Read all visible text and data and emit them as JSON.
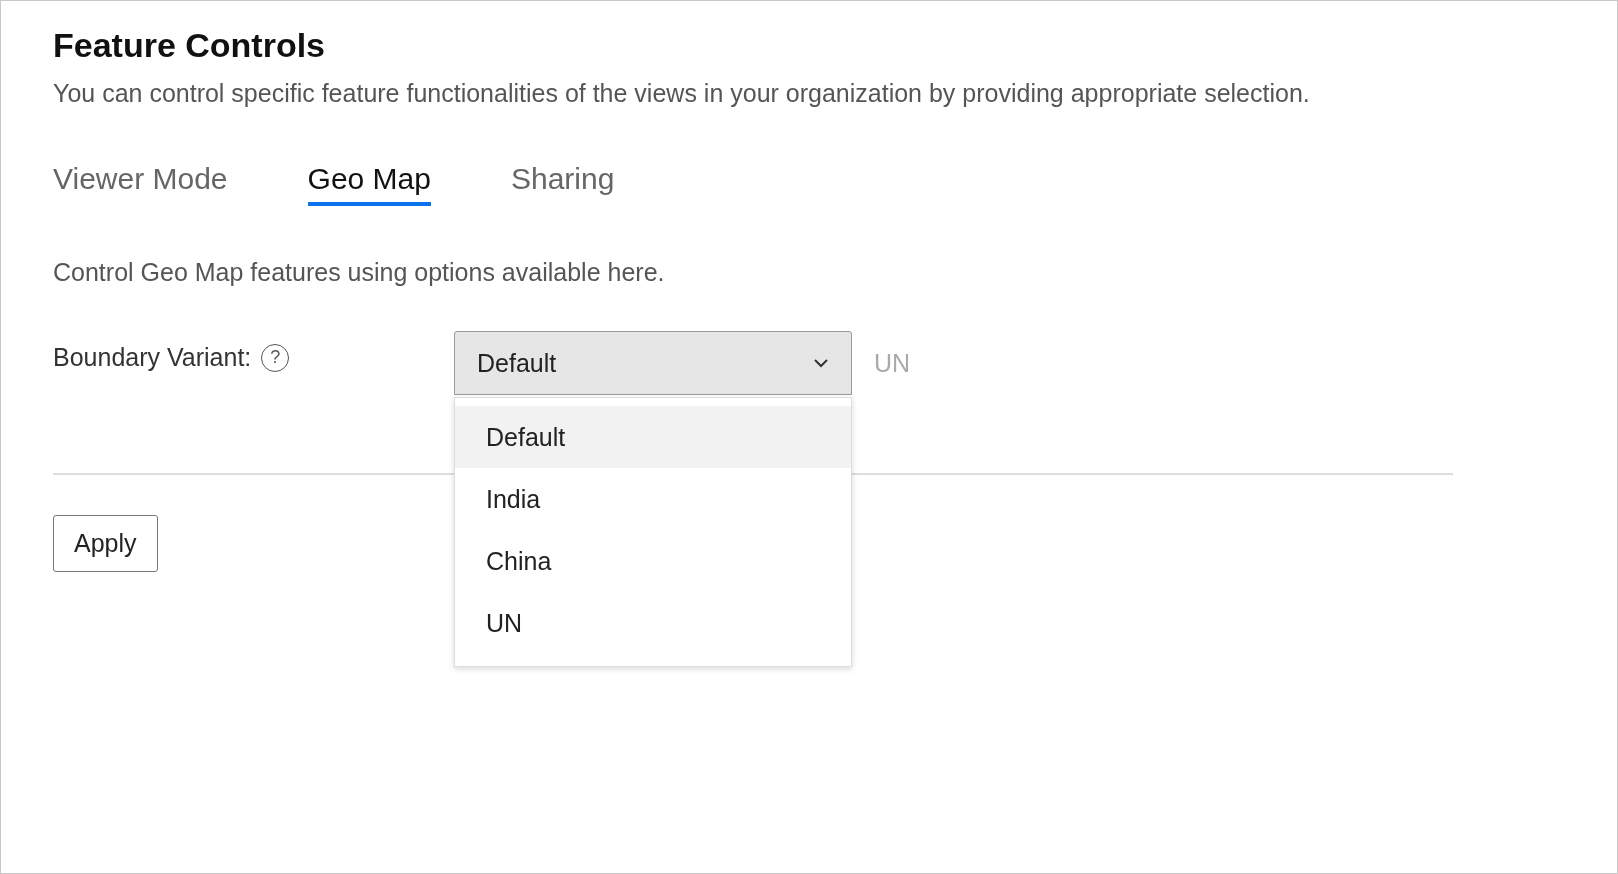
{
  "header": {
    "title": "Feature Controls",
    "description": "You can control specific feature functionalities of the views in your organization by providing appropriate selection."
  },
  "tabs": [
    {
      "label": "Viewer Mode",
      "selected": false
    },
    {
      "label": "Geo Map",
      "selected": true
    },
    {
      "label": "Sharing",
      "selected": false
    }
  ],
  "section": {
    "description": "Control Geo Map features using options available here."
  },
  "boundary_variant": {
    "label": "Boundary Variant:",
    "help_icon": "?",
    "value": "Default",
    "expanded": true,
    "current_value": "UN",
    "options": [
      {
        "label": "Default",
        "selected": true
      },
      {
        "label": "India",
        "selected": false
      },
      {
        "label": "China",
        "selected": false
      },
      {
        "label": "UN",
        "selected": false
      }
    ]
  },
  "buttons": [
    {
      "label": "Apply"
    }
  ]
}
